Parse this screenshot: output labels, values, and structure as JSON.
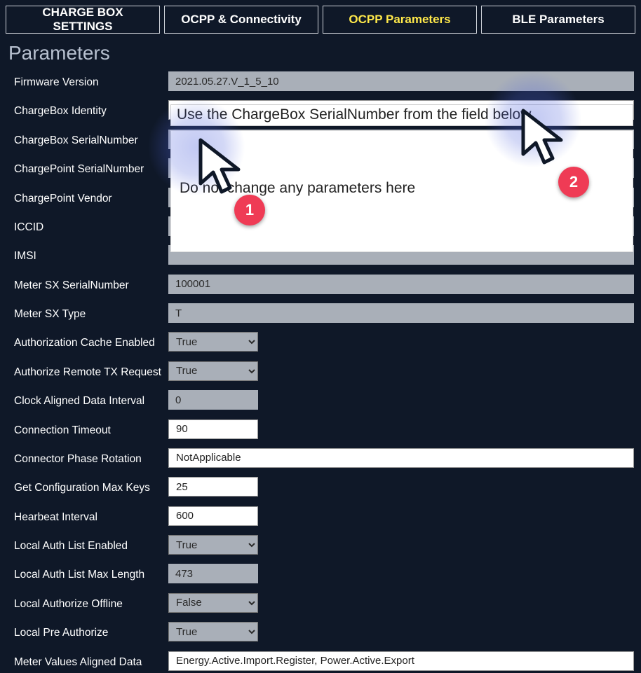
{
  "tabs": {
    "t0": "CHARGE BOX SETTINGS",
    "t1": "OCPP & Connectivity",
    "t2": "OCPP Parameters",
    "t3": "BLE Parameters"
  },
  "page_title": "Parameters",
  "overlay": {
    "identity_hint": "Use the ChargeBox SerialNumber from the field below",
    "warning": "Do not change any parameters here",
    "badge1": "1",
    "badge2": "2"
  },
  "labels": {
    "firmware_version": "Firmware Version",
    "chargebox_identity": "ChargeBox Identity",
    "chargebox_serial": "ChargeBox SerialNumber",
    "chargepoint_serial": "ChargePoint SerialNumber",
    "chargepoint_vendor": "ChargePoint Vendor",
    "iccid": "ICCID",
    "imsi": "IMSI",
    "meter_sx_serial": "Meter SX SerialNumber",
    "meter_sx_type": "Meter SX Type",
    "auth_cache_enabled": "Authorization Cache Enabled",
    "auth_remote_tx": "Authorize Remote TX Request",
    "clock_aligned": "Clock Aligned Data Interval",
    "conn_timeout": "Connection Timeout",
    "conn_phase_rot": "Connector Phase Rotation",
    "get_cfg_max": "Get Configuration Max Keys",
    "heartbeat": "Hearbeat Interval",
    "local_auth_enabled": "Local Auth List Enabled",
    "local_auth_max": "Local Auth List Max Length",
    "local_auth_offline": "Local Authorize Offline",
    "local_pre_auth": "Local Pre Authorize",
    "meter_values_aligned": "Meter Values Aligned Data"
  },
  "values": {
    "firmware_version": "2021.05.27.V_1_5_10",
    "meter_sx_serial": "100001",
    "meter_sx_type": "T",
    "auth_cache_enabled": "True",
    "auth_remote_tx": "True",
    "clock_aligned": "0",
    "conn_timeout": "90",
    "conn_phase_rot": "NotApplicable",
    "get_cfg_max": "25",
    "heartbeat": "600",
    "local_auth_enabled": "True",
    "local_auth_max": "473",
    "local_auth_offline": "False",
    "local_pre_auth": "True",
    "meter_values_aligned": "Energy.Active.Import.Register, Power.Active.Export"
  },
  "select_options": {
    "true": "True",
    "false": "False"
  }
}
